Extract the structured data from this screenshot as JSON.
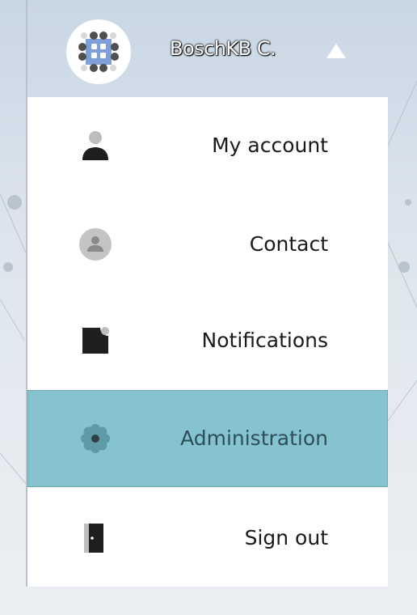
{
  "user": {
    "name": "BoschKB C."
  },
  "menu": {
    "items": [
      {
        "label": "My account",
        "icon": "person-icon"
      },
      {
        "label": "Contact",
        "icon": "contact-circle-icon"
      },
      {
        "label": "Notifications",
        "icon": "notification-icon"
      },
      {
        "label": "Administration",
        "icon": "gear-icon",
        "active": true
      },
      {
        "label": "Sign out",
        "icon": "door-exit-icon"
      }
    ]
  },
  "colors": {
    "active_background": "#85c3d0",
    "menu_background": "#ffffff",
    "avatar_accent": "#7f9fd8"
  }
}
